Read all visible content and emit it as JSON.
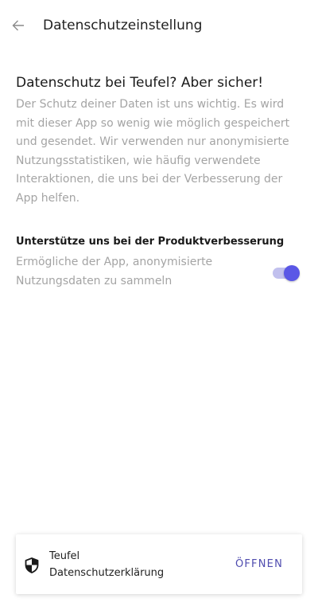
{
  "header": {
    "title": "Datenschutzeinstellung",
    "back_icon": "arrow-left-icon"
  },
  "intro": {
    "heading": "Datenschutz bei Teufel? Aber sicher!",
    "text": "Der Schutz deiner Daten ist uns wichtig. Es wird mit dieser App so wenig wie möglich gespeichert und gesendet. Wir verwenden nur anonymisierte Nutzungsstatistiken, wie häufig verwendete Interaktionen, die uns bei der Verbesserung der App helfen."
  },
  "setting": {
    "title": "Unterstütze uns bei der Produktverbesserung",
    "description": "Ermögliche der App, anonymisierte Nutzungsdaten zu sammeln",
    "enabled": true
  },
  "privacy_card": {
    "icon": "shield-icon",
    "line1": "Teufel",
    "line2": "Datenschutzerklärung",
    "action_label": "ÖFFNEN"
  },
  "colors": {
    "accent": "#5a57e6",
    "accent_light": "#c1c0ee",
    "action_text": "#4f4caf",
    "muted_text": "#a4a4a4"
  }
}
